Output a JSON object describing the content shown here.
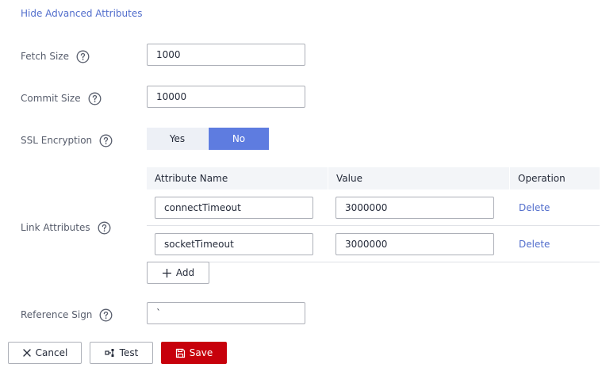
{
  "header": {
    "toggle_label": "Hide Advanced Attributes"
  },
  "fields": {
    "fetch_size": {
      "label": "Fetch Size",
      "value": "1000"
    },
    "commit_size": {
      "label": "Commit Size",
      "value": "10000"
    },
    "ssl_encryption": {
      "label": "SSL Encryption",
      "options": [
        "Yes",
        "No"
      ],
      "selected": "No"
    },
    "link_attributes": {
      "label": "Link Attributes"
    },
    "reference_sign": {
      "label": "Reference Sign",
      "value": "`"
    }
  },
  "attributes_table": {
    "columns": [
      "Attribute Name",
      "Value",
      "Operation"
    ],
    "rows": [
      {
        "name": "connectTimeout",
        "value": "3000000",
        "action": "Delete"
      },
      {
        "name": "socketTimeout",
        "value": "3000000",
        "action": "Delete"
      }
    ],
    "add_label": "Add"
  },
  "footer": {
    "cancel_label": "Cancel",
    "test_label": "Test",
    "save_label": "Save"
  },
  "colors": {
    "accent": "#5e7ce0",
    "link": "#526ecc",
    "danger": "#c7000b"
  },
  "icons": {
    "help": "question-circle-icon",
    "add": "plus-icon",
    "cancel": "close-icon",
    "test": "connection-test-icon",
    "save": "floppy-disk-icon"
  }
}
